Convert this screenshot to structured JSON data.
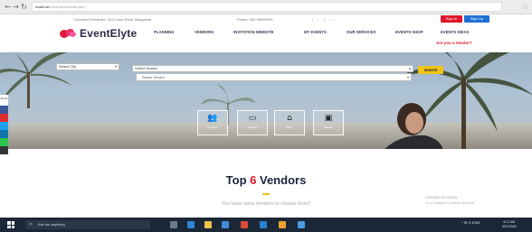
{
  "browser": {
    "back": "←",
    "forward": "→",
    "reload": "↻",
    "address_host": "localhost",
    "address_path": "/eventelyte/index.php",
    "star_icon": "☆"
  },
  "header": {
    "contact": "Connect Eventelyte, 3rd Cross Road, Bangalore",
    "phone": "Phone: 080 99999999",
    "social": "f  t  g  in",
    "signin_label": "Sign In",
    "signup_label": "Sign Up",
    "logo_text": "EventElyte",
    "menu": [
      "PLANNING",
      "VENDORS",
      "INVITATION WEBSITE",
      "MY EVENTS",
      "OUR SERVICES",
      "EVENTS SHOP",
      "EVENTS IDEAS"
    ],
    "vendor_question": "Are you a Vendor?"
  },
  "hero": {
    "city_select": "Select City",
    "vendor_select": "Select Vendor",
    "vendor_select_option": "Select Vendor",
    "search_label": "search",
    "features": [
      {
        "icon": "vendors-icon",
        "label": "Vendors"
      },
      {
        "icon": "website-icon",
        "label": "Website"
      },
      {
        "icon": "shop-icon",
        "label": "Shop"
      },
      {
        "icon": "planner-icon",
        "label": "Planner"
      }
    ]
  },
  "share": {
    "label": "Share",
    "colors": [
      "#3b5998",
      "#e02d2d",
      "#1da1f2",
      "#0e76a8",
      "#2ec34a",
      "#333333"
    ]
  },
  "vendors_section": {
    "title_prefix": "Top ",
    "title_number": "6",
    "title_suffix": " Vendors",
    "subtitle": "You have more vendors to choose from!!"
  },
  "watermark": {
    "line1": "Activate Windows",
    "line2": "Go to Settings to activate Windows."
  },
  "taskbar": {
    "search_placeholder": "Ask me anything",
    "tray": "^  ✉  ⊙  ENG",
    "time": "9:17 AM",
    "date": "3/21/2018"
  },
  "colors": {
    "accent_red": "#e0162b",
    "accent_blue": "#1f6fd6",
    "search_yellow": "#f2c318",
    "title_navy": "#1f2240"
  }
}
